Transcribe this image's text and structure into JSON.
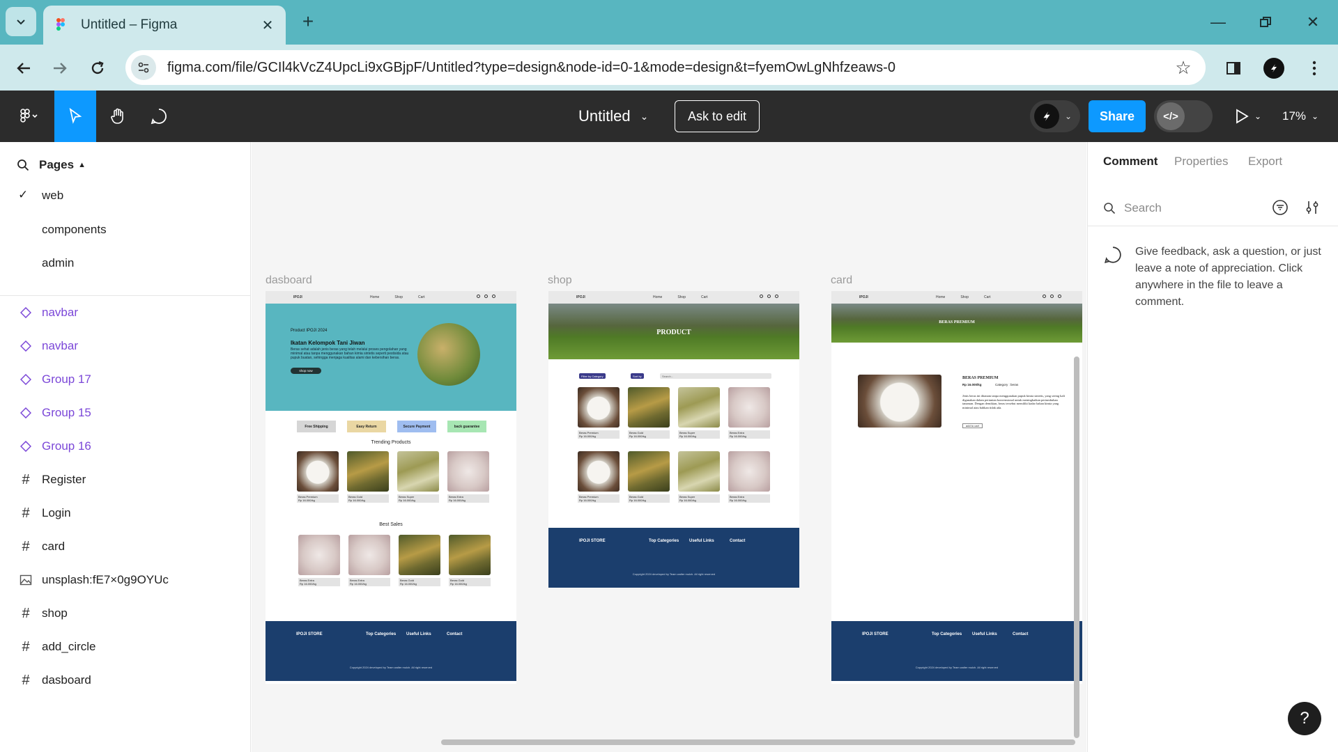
{
  "browser": {
    "tab_title": "Untitled – Figma",
    "url": "figma.com/file/GCIl4kVcZ4UpcLi9xGBjpF/Untitled?type=design&node-id=0-1&mode=design&t=fyemOwLgNhfzeaws-0"
  },
  "toolbar": {
    "file_title": "Untitled",
    "ask_to_edit": "Ask to edit",
    "share": "Share",
    "dev_label": "</>",
    "zoom": "17%"
  },
  "pages": {
    "header": "Pages",
    "items": [
      "web",
      "components",
      "admin"
    ],
    "current": "web"
  },
  "layers": [
    {
      "name": "navbar",
      "kind": "component"
    },
    {
      "name": "navbar",
      "kind": "component"
    },
    {
      "name": "Group 17",
      "kind": "component"
    },
    {
      "name": "Group 15",
      "kind": "component"
    },
    {
      "name": "Group 16",
      "kind": "component"
    },
    {
      "name": "Register",
      "kind": "frame"
    },
    {
      "name": "Login",
      "kind": "frame"
    },
    {
      "name": "card",
      "kind": "frame"
    },
    {
      "name": "unsplash:fE7×0g9OYUc",
      "kind": "image"
    },
    {
      "name": "shop",
      "kind": "frame"
    },
    {
      "name": "add_circle",
      "kind": "frame"
    },
    {
      "name": "dasboard",
      "kind": "frame"
    }
  ],
  "canvas": {
    "frames": [
      {
        "label": "dasboard"
      },
      {
        "label": "shop"
      },
      {
        "label": "card"
      }
    ],
    "mini": {
      "brand": "IPOJI",
      "nav_links": [
        "Home",
        "Shop",
        "Cart"
      ],
      "hero_small": "Product IPOJI 2024",
      "hero_title": "Ikatan Kelompok Tani Jiwan",
      "hero_text": "Beras sehat adalah jenis beras yang telah melalui proses pengolahan yang minimal atau tanpa menggunakan bahan kimia sintetis seperti pestisida atau pupuk buatan, sehingga menjaga kualitas alami dan kebersihan beras.",
      "hero_button": "shop now",
      "features": [
        "Free Shipping",
        "Easy Return",
        "Secure Payment",
        "back guarantee"
      ],
      "trending_title": "Trending Products",
      "best_title": "Best Sales",
      "trending": [
        "Beras Premium",
        "Beras Gold",
        "Beras Super",
        "Beras Extra"
      ],
      "best": [
        "Beras Extra",
        "Beras Extra",
        "Beras Gold",
        "Beras Gold"
      ],
      "price": "Rp 16.000/kg",
      "shop_banner": "PRODUCT",
      "shop_filter": "Filter by Category",
      "shop_sort": "Sort by",
      "shop_search": "Search...",
      "card_banner": "BERAS PREMIUM",
      "card_title": "BERAS PREMIUM",
      "card_price": "Rp 16.000/kg",
      "card_category": "Category : beras",
      "card_desc": "Jenis beras ini ditanam tanpa menggunakan pupuk kimia sintetis, yang sering kali digunakan dalam pertanian konvensional untuk meningkatkan pertumbuhan tanaman. Dengan demikian, beras tersebut memiliki kadar bahan kimia yang minimal atau bahkan tidak ada.",
      "card_button": "add to cart",
      "footer_store": "IPOJI STORE",
      "footer_top": "Top Categories",
      "footer_links": "Useful Links",
      "footer_contact": "Contact",
      "footer_copy": "Copyright 2024 developed by Team walter mulch. All right reserved"
    }
  },
  "comment_panel": {
    "tabs": [
      "Comment",
      "Properties",
      "Export"
    ],
    "active_tab": "Comment",
    "search_placeholder": "Search",
    "hint": "Give feedback, ask a question, or just leave a note of appreciation. Click anywhere in the file to leave a comment."
  },
  "help_label": "?",
  "colors": {
    "tabbar": "#58b6c0",
    "figma_toolbar": "#2c2c2c",
    "accent": "#0d99ff",
    "component": "#7b47d8",
    "footer": "#1b3e6d"
  }
}
